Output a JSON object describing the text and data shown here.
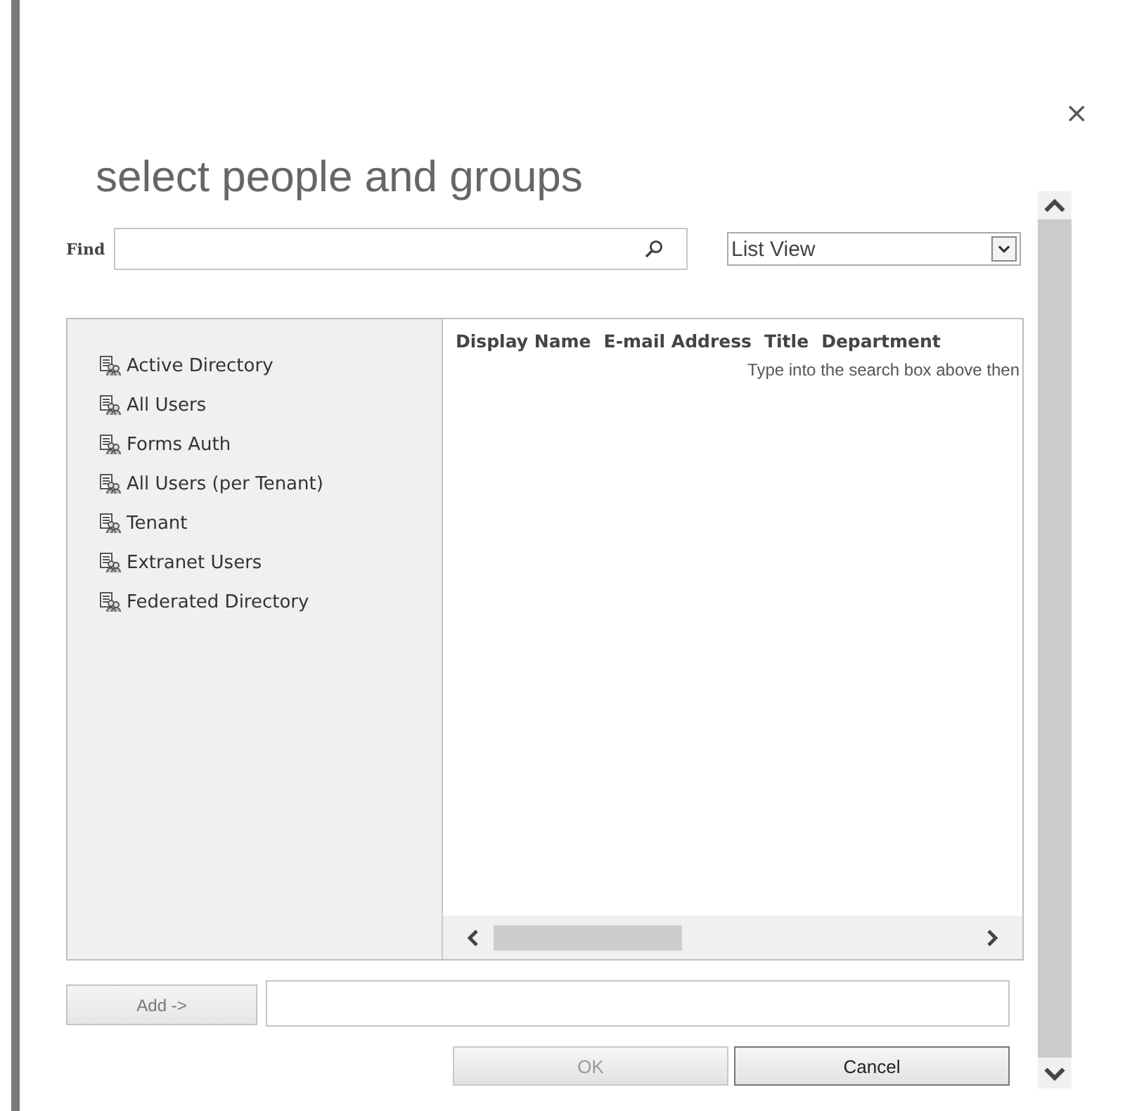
{
  "dialog": {
    "title": "select people and groups",
    "close": "×"
  },
  "find": {
    "label": "Find"
  },
  "view_select": {
    "value": "List View"
  },
  "directories": [
    {
      "label": "Active Directory"
    },
    {
      "label": "All Users"
    },
    {
      "label": "Forms Auth"
    },
    {
      "label": "All Users (per Tenant)"
    },
    {
      "label": "Tenant"
    },
    {
      "label": "Extranet Users"
    },
    {
      "label": "Federated Directory"
    }
  ],
  "results": {
    "columns": [
      "Display Name",
      "E-mail Address",
      "Title",
      "Department"
    ],
    "hint": "Type into the search box above then"
  },
  "add": {
    "button": "Add ->"
  },
  "buttons": [
    {
      "label": "OK",
      "disabled": true
    },
    {
      "label": "Cancel",
      "disabled": false
    }
  ]
}
